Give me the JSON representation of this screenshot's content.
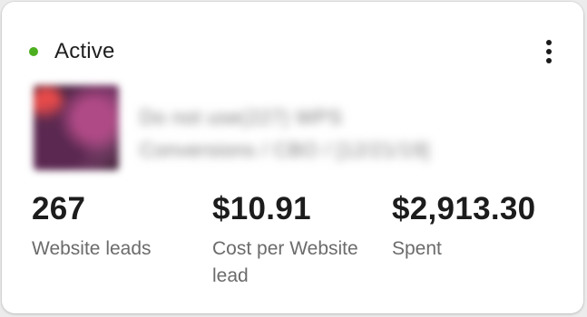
{
  "card": {
    "status": {
      "text": "Active",
      "color": "#4caf1f"
    },
    "menu_icon": "more-vertical-icon",
    "title_line_1": "Do not use(227) WPS",
    "title_line_2": "Conversions / CBO / [12/21/19]",
    "metrics": [
      {
        "value": "267",
        "label": "Website leads"
      },
      {
        "value": "$10.91",
        "label": "Cost per Website lead"
      },
      {
        "value": "$2,913.30",
        "label": "Spent"
      }
    ]
  }
}
